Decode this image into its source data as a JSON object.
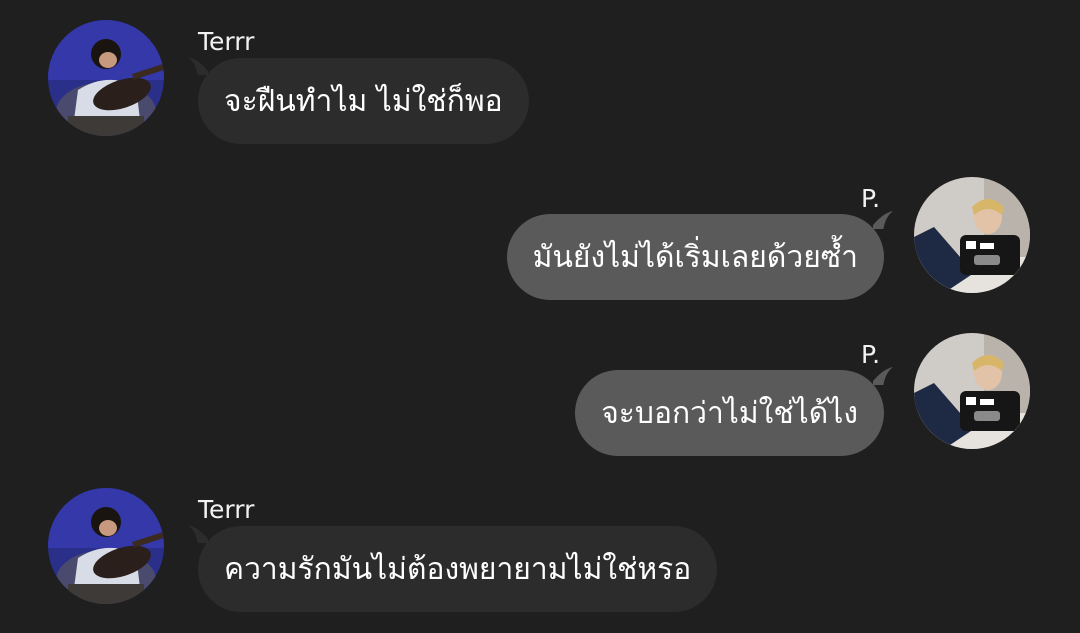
{
  "messages": [
    {
      "sender": "Terrr",
      "text": "จะฝืนทำไม ไม่ใช่ก็พอ",
      "direction": "incoming"
    },
    {
      "sender": "P.",
      "text": "มันยังไม่ได้เริ่มเลยด้วยซ้ำ",
      "direction": "outgoing"
    },
    {
      "sender": "P.",
      "text": "จะบอกว่าไม่ใช่ได้ไง",
      "direction": "outgoing"
    },
    {
      "sender": "Terrr",
      "text": "ความรักมันไม่ต้องพยายามไม่ใช่หรอ",
      "direction": "incoming"
    }
  ],
  "colors": {
    "background": "#1f1f1f",
    "incoming_bubble": "#2c2c2c",
    "outgoing_bubble": "#5a5a5a",
    "text": "#ffffff"
  },
  "icons": {
    "incoming_avatar": "guitar-player-avatar",
    "outgoing_avatar": "person-with-phone-avatar"
  }
}
